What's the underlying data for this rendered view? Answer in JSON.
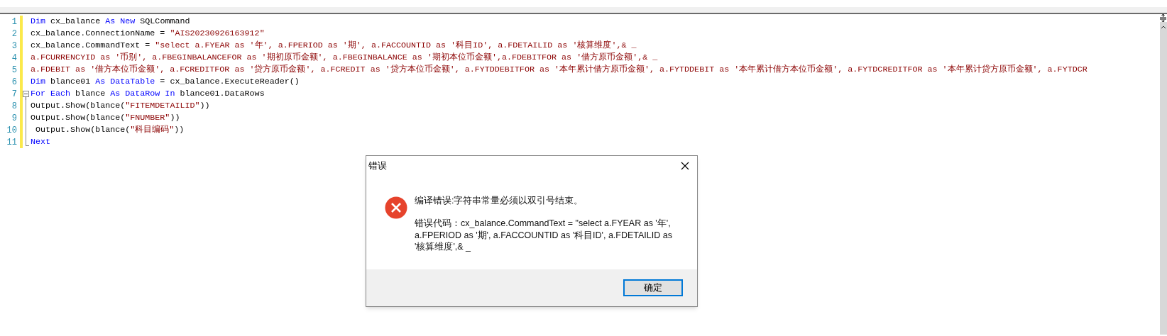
{
  "editor": {
    "lines": [
      {
        "number": "1",
        "fold_start": false,
        "in_fold": false,
        "tokens": [
          {
            "kind": "keyword",
            "text": "Dim"
          },
          {
            "kind": "plain",
            "text": " cx_balance "
          },
          {
            "kind": "keyword",
            "text": "As New"
          },
          {
            "kind": "plain",
            "text": " SQLCommand"
          }
        ]
      },
      {
        "number": "2",
        "fold_start": false,
        "in_fold": false,
        "tokens": [
          {
            "kind": "plain",
            "text": "cx_balance.ConnectionName = "
          },
          {
            "kind": "string",
            "text": "\"AIS20230926163912\""
          }
        ]
      },
      {
        "number": "3",
        "fold_start": false,
        "in_fold": false,
        "tokens": [
          {
            "kind": "plain",
            "text": "cx_balance.CommandText = "
          },
          {
            "kind": "string",
            "text": "\"select a.FYEAR as '年', a.FPERIOD as '期', a.FACCOUNTID as '科目ID', a.FDETAILID as '核算维度',& _"
          }
        ]
      },
      {
        "number": "4",
        "fold_start": false,
        "in_fold": false,
        "tokens": [
          {
            "kind": "string",
            "text": "a.FCURRENCYID as '币别', a.FBEGINBALANCEFOR as '期初原币金额', a.FBEGINBALANCE as '期初本位币金额',a.FDEBITFOR as '借方原币金额',& _"
          }
        ]
      },
      {
        "number": "5",
        "fold_start": false,
        "in_fold": false,
        "tokens": [
          {
            "kind": "string",
            "text": "a.FDEBIT as '借方本位币金额', a.FCREDITFOR as '贷方原币金额', a.FCREDIT as '贷方本位币金额', a.FYTDDEBITFOR as '本年累计借方原币金额', a.FYTDDEBIT as '本年累计借方本位币金额', a.FYTDCREDITFOR as '本年累计贷方原币金额', a.FYTDCR"
          }
        ]
      },
      {
        "number": "6",
        "fold_start": false,
        "in_fold": false,
        "tokens": [
          {
            "kind": "keyword",
            "text": "Dim"
          },
          {
            "kind": "plain",
            "text": " blance01 "
          },
          {
            "kind": "keyword",
            "text": "As DataTable"
          },
          {
            "kind": "plain",
            "text": " = cx_balance.ExecuteReader()"
          }
        ]
      },
      {
        "number": "7",
        "fold_start": true,
        "in_fold": false,
        "tokens": [
          {
            "kind": "keyword",
            "text": "For Each"
          },
          {
            "kind": "plain",
            "text": " blance "
          },
          {
            "kind": "keyword",
            "text": "As DataRow In"
          },
          {
            "kind": "plain",
            "text": " blance01.DataRows"
          }
        ]
      },
      {
        "number": "8",
        "fold_start": false,
        "in_fold": true,
        "tokens": [
          {
            "kind": "plain",
            "text": "Output.Show(blance("
          },
          {
            "kind": "string",
            "text": "\"FITEMDETAILID\""
          },
          {
            "kind": "plain",
            "text": "))"
          }
        ]
      },
      {
        "number": "9",
        "fold_start": false,
        "in_fold": true,
        "tokens": [
          {
            "kind": "plain",
            "text": "Output.Show(blance("
          },
          {
            "kind": "string",
            "text": "\"FNUMBER\""
          },
          {
            "kind": "plain",
            "text": "))"
          }
        ]
      },
      {
        "number": "10",
        "fold_start": false,
        "in_fold": true,
        "tokens": [
          {
            "kind": "plain",
            "text": " Output.Show(blance("
          },
          {
            "kind": "string",
            "text": "\"科目编码\""
          },
          {
            "kind": "plain",
            "text": "))"
          }
        ]
      },
      {
        "number": "11",
        "fold_start": false,
        "in_fold": true,
        "tokens": [
          {
            "kind": "keyword",
            "text": "Next"
          }
        ]
      }
    ]
  },
  "dialog": {
    "title": "错误",
    "message": "编译错误:字符串常量必须以双引号结束。",
    "detail": "错误代码：cx_balance.CommandText = \"select a.FYEAR as '年', a.FPERIOD as '期', a.FACCOUNTID as '科目ID', a.FDETAILID as '核算维度',& _",
    "buttons": [
      "确定"
    ]
  }
}
